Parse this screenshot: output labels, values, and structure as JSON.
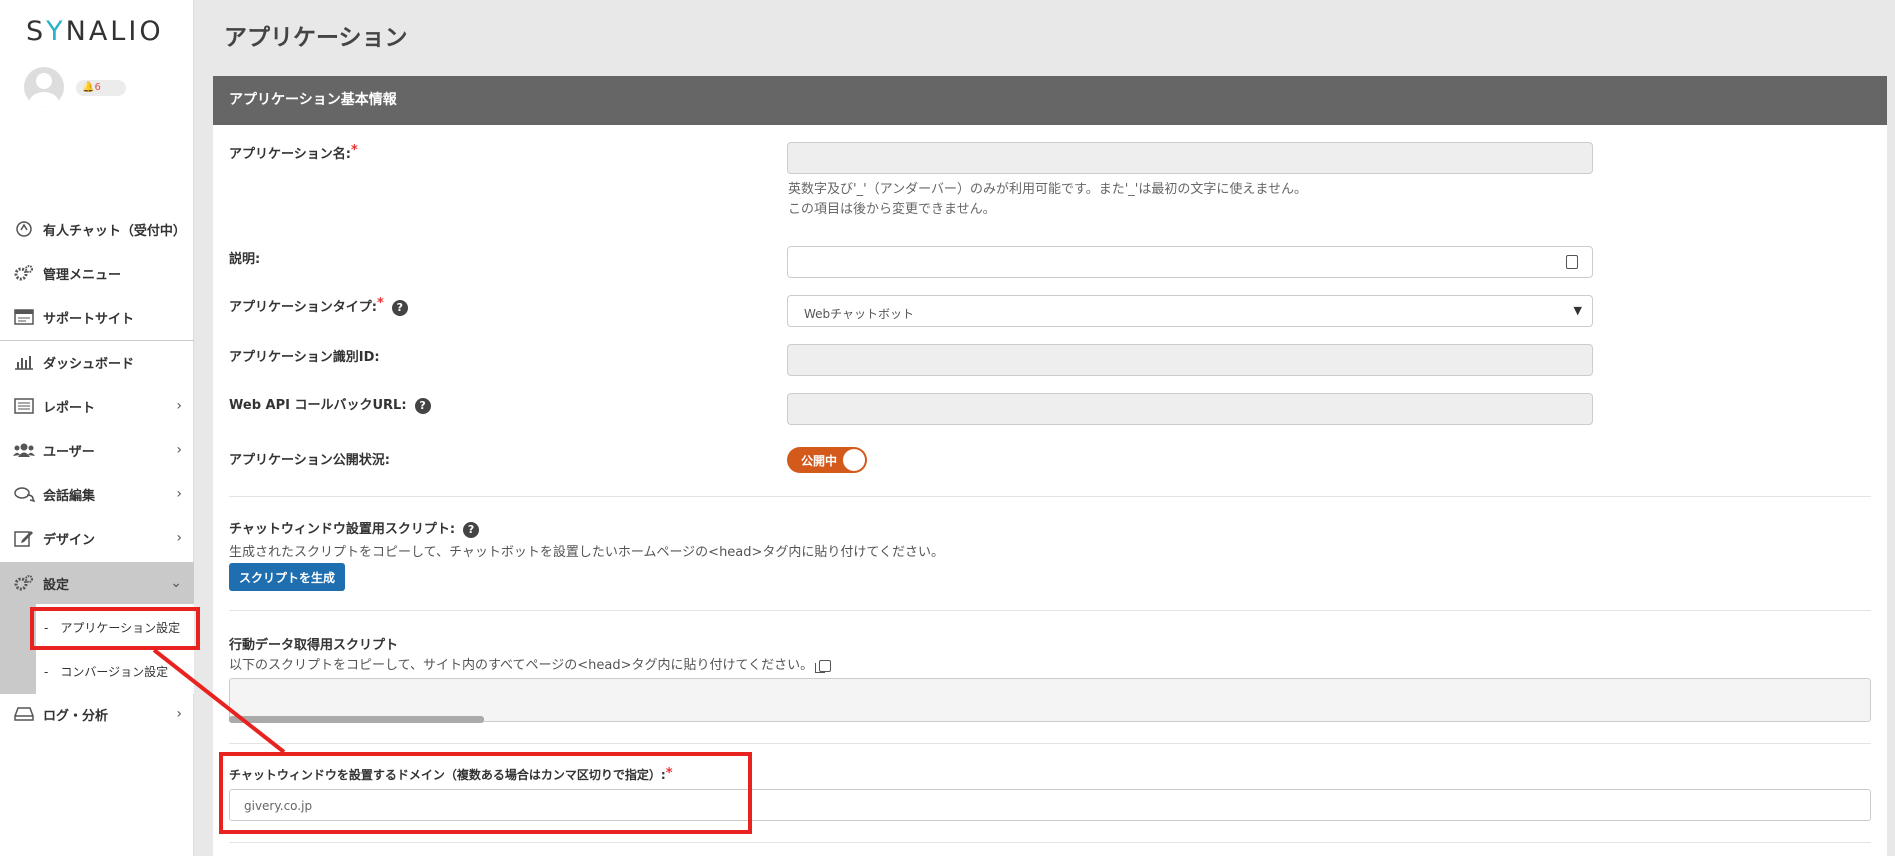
{
  "brand": {
    "logo_pre": "S",
    "logo_y": "Y",
    "logo_post": "NALIO"
  },
  "user": {
    "notifications": "6"
  },
  "sidebar": {
    "items": [
      {
        "label": "有人チャット（受付中）",
        "icon": "headset-icon"
      },
      {
        "label": "管理メニュー",
        "icon": "gears-icon"
      },
      {
        "label": "サポートサイト",
        "icon": "browser-window-icon"
      },
      {
        "label": "ダッシュボード",
        "icon": "bar-chart-icon"
      },
      {
        "label": "レポート",
        "icon": "list-icon"
      },
      {
        "label": "ユーザー",
        "icon": "users-icon"
      },
      {
        "label": "会話編集",
        "icon": "chat-bubbles-icon"
      },
      {
        "label": "デザイン",
        "icon": "edit-icon"
      },
      {
        "label": "設定",
        "icon": "gears-icon"
      },
      {
        "label": "ログ・分析",
        "icon": "drive-icon"
      }
    ],
    "sub_items": [
      {
        "label": "-　アプリケーション設定"
      },
      {
        "label": "-　コンバージョン設定"
      }
    ]
  },
  "page": {
    "title": "アプリケーション"
  },
  "card": {
    "header": "アプリケーション基本情報",
    "app_name": {
      "label": "アプリケーション名:",
      "required": "*",
      "value": "",
      "hint_1": "英数字及び'_'（アンダーバー）のみが利用可能です。また'_'は最初の文字に使えません。",
      "hint_2": "この項目は後から変更できません。"
    },
    "description": {
      "label": "説明:",
      "value": ""
    },
    "app_type": {
      "label": "アプリケーションタイプ:",
      "required": "*",
      "selected": "Webチャットボット"
    },
    "app_id": {
      "label": "アプリケーション識別ID:",
      "value": ""
    },
    "callback_url": {
      "label": "Web API コールバックURL:",
      "value": ""
    },
    "publish_status": {
      "label": "アプリケーション公開状況:",
      "toggle_label": "公開中",
      "toggle_state": "on"
    },
    "chat_script": {
      "label": "チャットウィンドウ設置用スクリプト:",
      "description": "生成されたスクリプトをコピーして、チャットボットを設置したいホームページの<head>タグ内に貼り付けてください。",
      "button": "スクリプトを生成"
    },
    "behavior_script": {
      "label": "行動データ取得用スクリプト",
      "description": "以下のスクリプトをコピーして、サイト内のすべてページの<head>タグ内に貼り付けてください。"
    },
    "domain": {
      "label": "チャットウィンドウを設置するドメイン（複数ある場合はカンマ区切りで指定）:",
      "required": "*",
      "value": "givery.co.jp"
    }
  },
  "colors": {
    "accent_red": "#e8231f",
    "toggle_on": "#d45a1c",
    "primary_button": "#1f6fb0",
    "header_bg": "#666666"
  }
}
